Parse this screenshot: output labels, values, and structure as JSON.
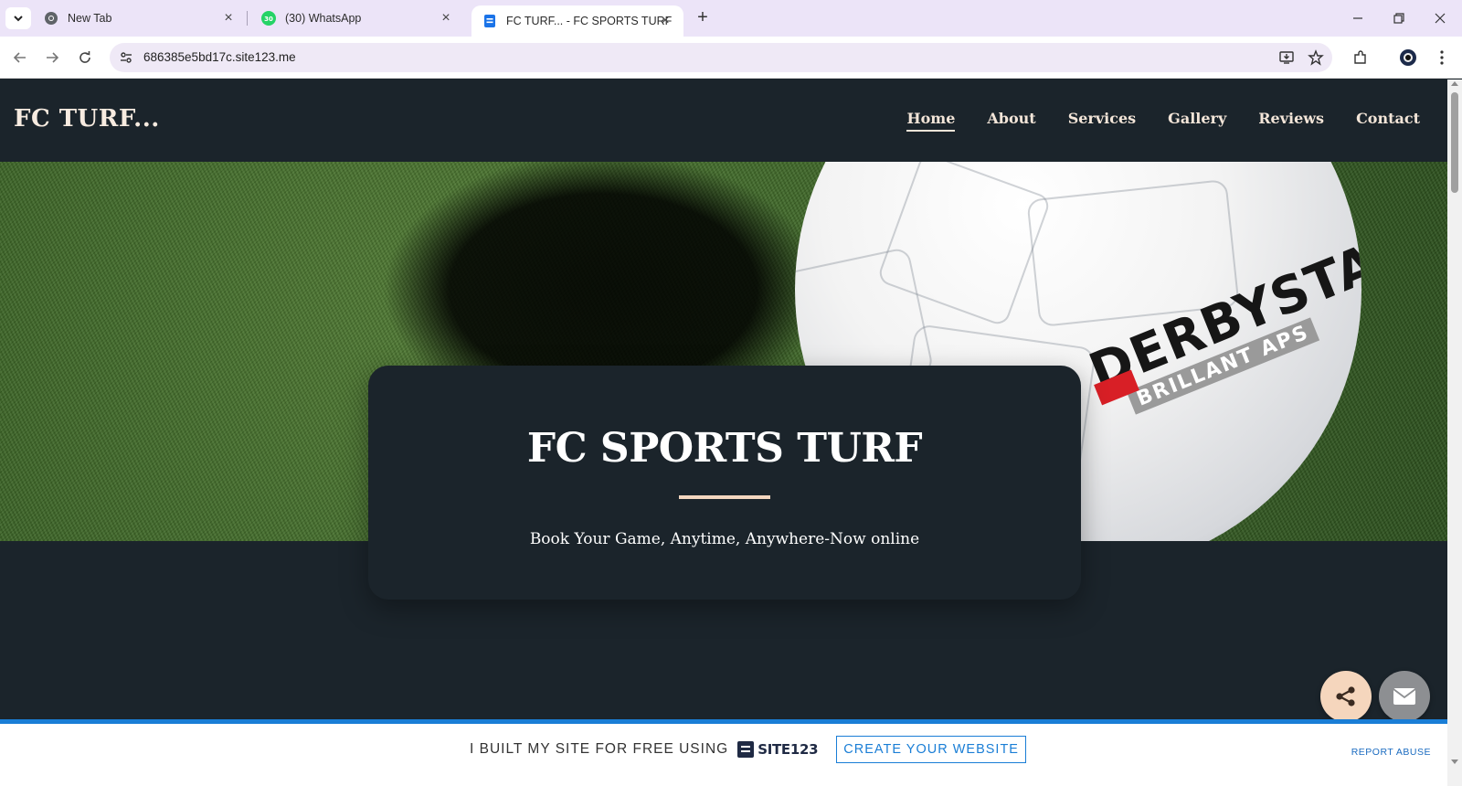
{
  "browser": {
    "tabs": [
      {
        "title": "New Tab",
        "icon": "chrome-icon",
        "active": false
      },
      {
        "title": "(30) WhatsApp",
        "icon": "whatsapp-icon",
        "badge": "30",
        "active": false
      },
      {
        "title": "FC TURF... - FC SPORTS TURF",
        "icon": "site123-page-icon",
        "active": true
      }
    ],
    "url": "686385e5bd17c.site123.me"
  },
  "site": {
    "logo": "FC TURF...",
    "nav": [
      {
        "label": "Home",
        "active": true
      },
      {
        "label": "About",
        "active": false
      },
      {
        "label": "Services",
        "active": false
      },
      {
        "label": "Gallery",
        "active": false
      },
      {
        "label": "Reviews",
        "active": false
      },
      {
        "label": "Contact",
        "active": false
      }
    ],
    "hero": {
      "ball_brand": "DERBYSTAR",
      "ball_subtitle": "BRILLANT APS",
      "title": "FC SPORTS TURF",
      "subtitle": "Book Your Game, Anytime, Anywhere-Now online"
    },
    "promo": {
      "text": "I BUILT MY SITE FOR FREE USING",
      "brand": "SITE123",
      "button": "CREATE YOUR WEBSITE",
      "report": "REPORT ABUSE"
    }
  },
  "colors": {
    "site_bg": "#1b242b",
    "accent_peach": "#f5d6bd",
    "promo_blue": "#1a7ed6",
    "tab_bar": "#ece4f8"
  }
}
